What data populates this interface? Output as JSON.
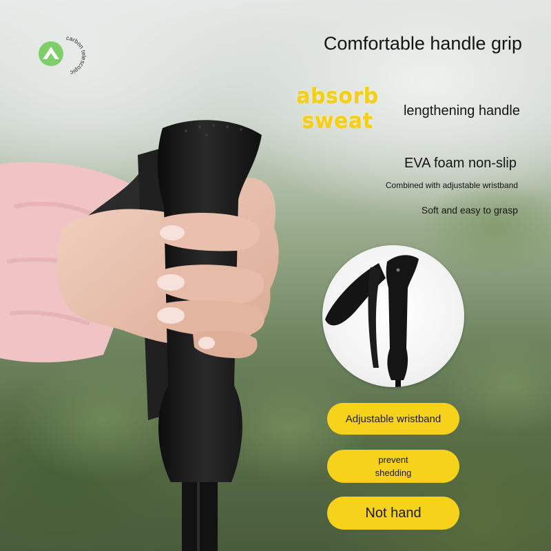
{
  "logo": {
    "text": "carbon telescopic"
  },
  "headline": "Comfortable handle grip",
  "badge": {
    "line1": "absorb",
    "line2": "sweat"
  },
  "features": {
    "lengthening": "lengthening handle",
    "eva": "EVA foam non-slip",
    "wristband_note": "Combined with adjustable wristband",
    "soft": "Soft and easy to grasp"
  },
  "pills": {
    "wristband": "Adjustable wristband",
    "prevent_line1": "prevent",
    "prevent_line2": "shedding",
    "not_hand": "Not hand"
  },
  "colors": {
    "accent_yellow": "#f6d21a",
    "logo_green": "#7ecf6a",
    "grip_black": "#1c1c1c"
  }
}
